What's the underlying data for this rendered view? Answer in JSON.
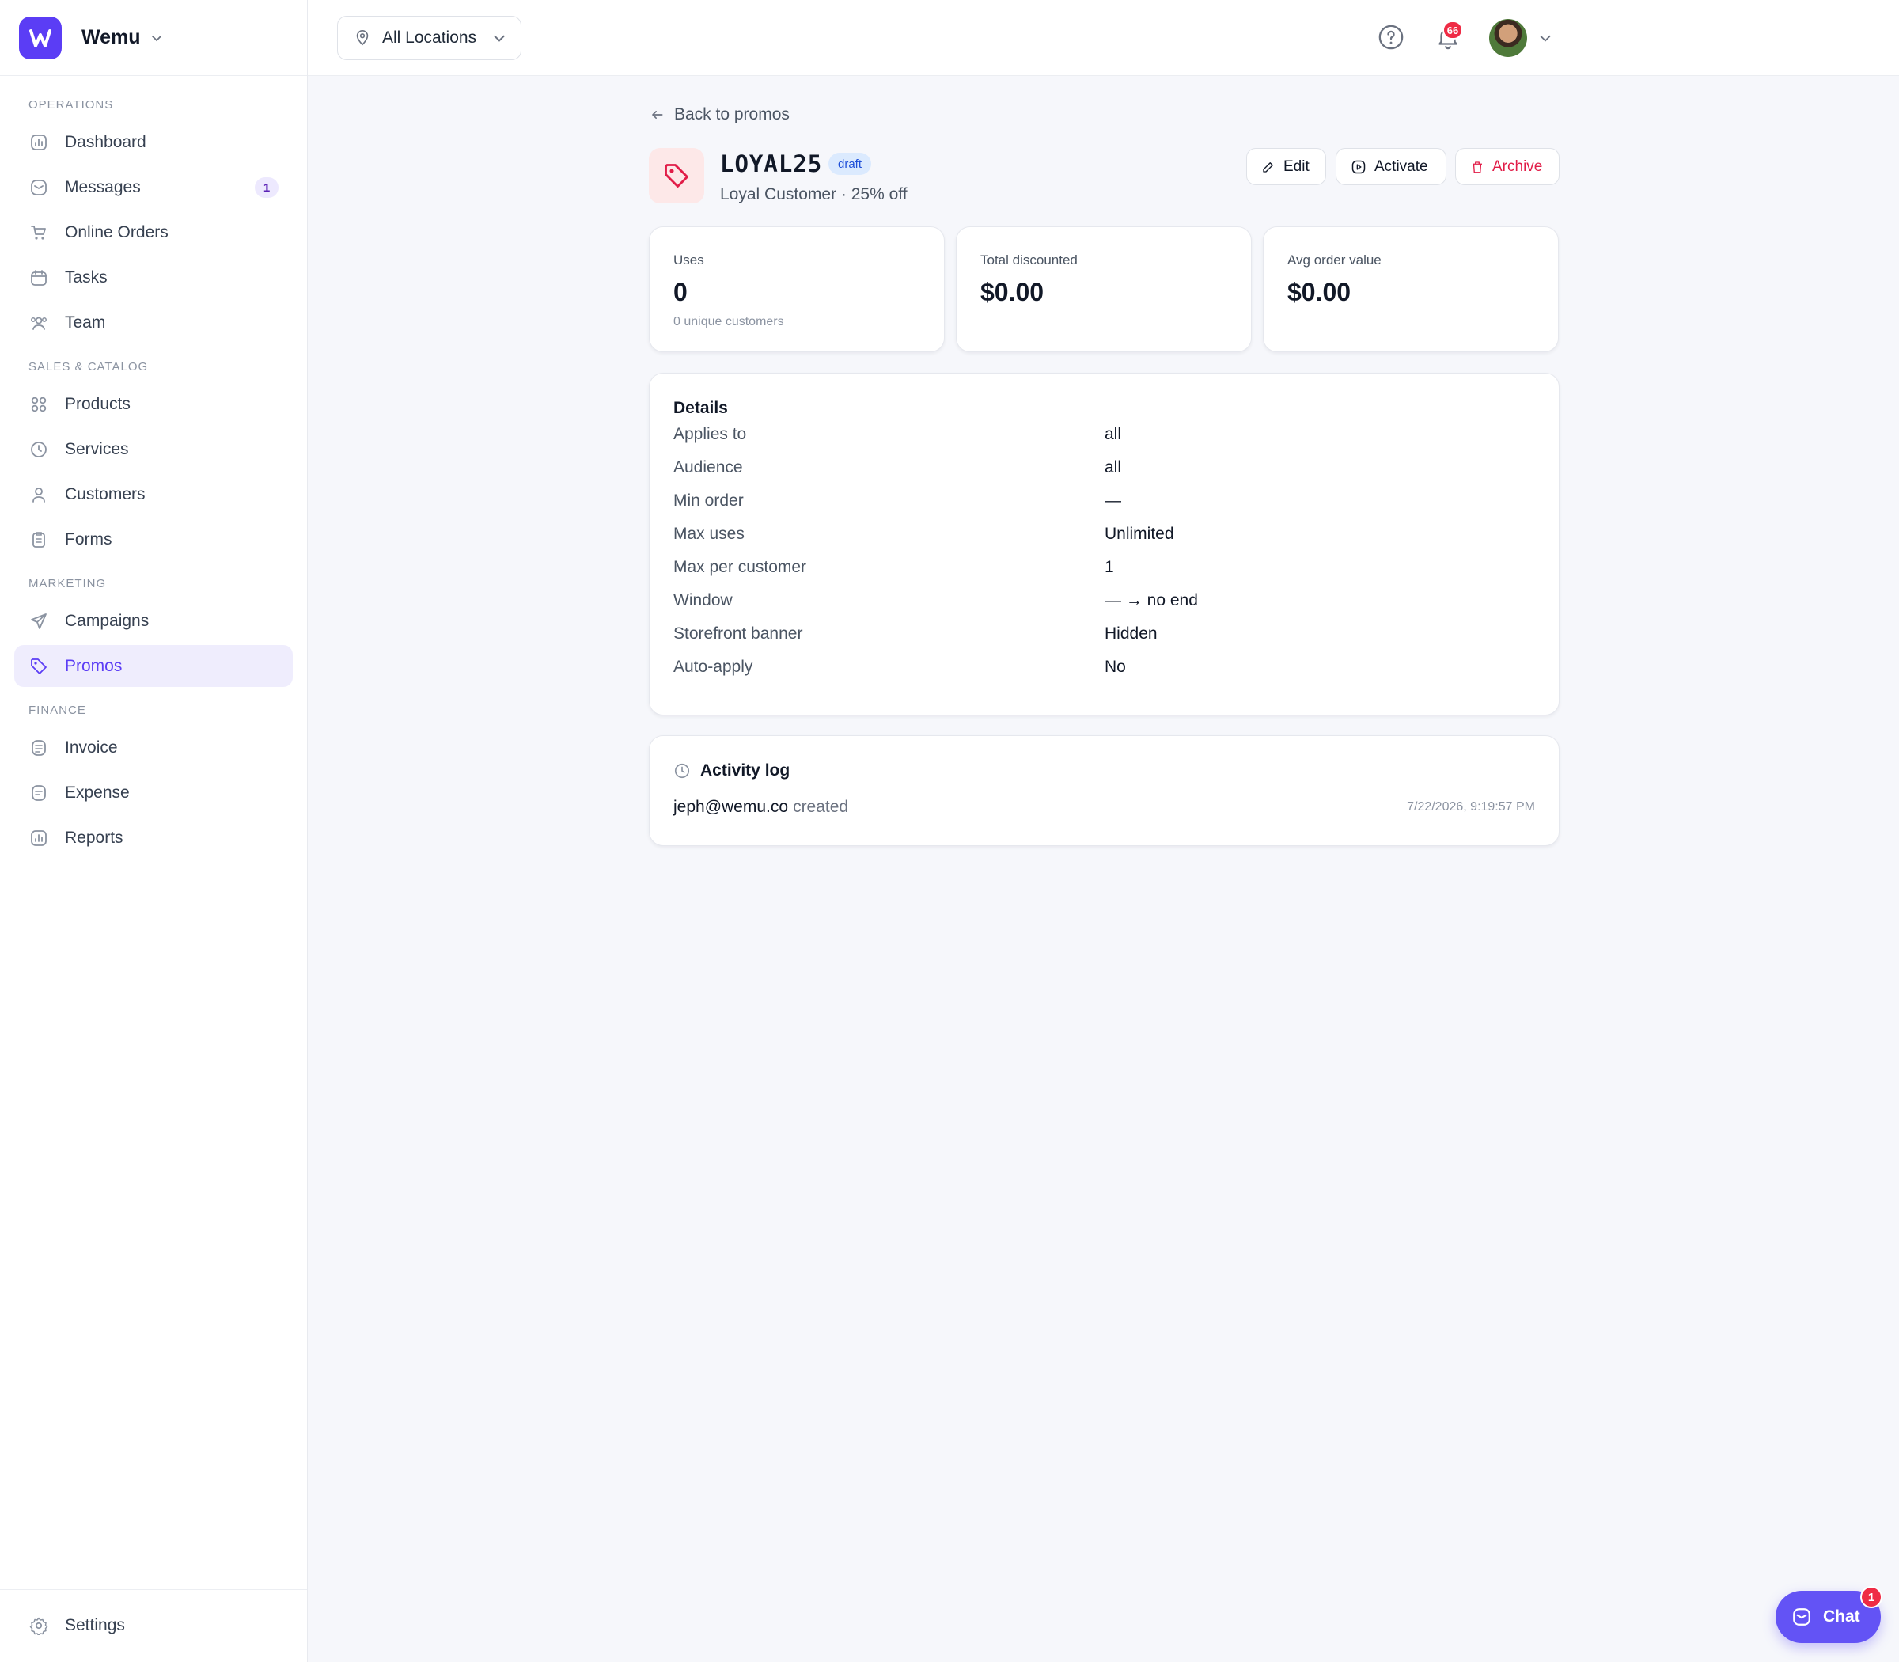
{
  "app": {
    "name": "Wemu"
  },
  "header": {
    "location": "All Locations",
    "notification_count": "66"
  },
  "sidebar": {
    "sections": [
      {
        "label": "OPERATIONS",
        "items": [
          {
            "label": "Dashboard",
            "icon": "chart-icon"
          },
          {
            "label": "Messages",
            "icon": "inbox-icon",
            "badge": "1"
          },
          {
            "label": "Online Orders",
            "icon": "cart-icon"
          },
          {
            "label": "Tasks",
            "icon": "calendar-icon"
          },
          {
            "label": "Team",
            "icon": "users-icon"
          }
        ]
      },
      {
        "label": "SALES & CATALOG",
        "items": [
          {
            "label": "Products",
            "icon": "grid-icon"
          },
          {
            "label": "Services",
            "icon": "clock-icon"
          },
          {
            "label": "Customers",
            "icon": "user-icon"
          },
          {
            "label": "Forms",
            "icon": "clipboard-icon"
          }
        ]
      },
      {
        "label": "MARKETING",
        "items": [
          {
            "label": "Campaigns",
            "icon": "send-icon"
          },
          {
            "label": "Promos",
            "icon": "tag-icon",
            "active": true
          }
        ]
      },
      {
        "label": "FINANCE",
        "items": [
          {
            "label": "Invoice",
            "icon": "document-icon"
          },
          {
            "label": "Expense",
            "icon": "receipt-icon"
          },
          {
            "label": "Reports",
            "icon": "chart-icon"
          }
        ]
      }
    ],
    "footer": {
      "label": "Settings",
      "icon": "gear-icon"
    }
  },
  "promo": {
    "back_label": "Back to promos",
    "code": "LOYAL25",
    "status": "draft",
    "subtitle": "Loyal Customer · 25% off",
    "actions": {
      "edit": "Edit",
      "activate": "Activate",
      "archive": "Archive"
    },
    "stats": [
      {
        "label": "Uses",
        "value": "0",
        "sub": "0 unique customers"
      },
      {
        "label": "Total discounted",
        "value": "$0.00",
        "sub": ""
      },
      {
        "label": "Avg order value",
        "value": "$0.00",
        "sub": ""
      }
    ],
    "details": {
      "title": "Details",
      "rows": [
        {
          "label": "Applies to",
          "value": "all"
        },
        {
          "label": "Audience",
          "value": "all"
        },
        {
          "label": "Min order",
          "value": "—"
        },
        {
          "label": "Max uses",
          "value": "Unlimited"
        },
        {
          "label": "Max per customer",
          "value": "1"
        },
        {
          "label": "Window",
          "value": "— → no end"
        },
        {
          "label": "Storefront banner",
          "value": "Hidden"
        },
        {
          "label": "Auto-apply",
          "value": "No"
        }
      ]
    },
    "activity": {
      "title": "Activity log",
      "entries": [
        {
          "user": "jeph@wemu.co",
          "action": "created",
          "time": "7/22/2026, 9:19:57 PM"
        }
      ]
    }
  },
  "chat": {
    "label": "Chat",
    "badge": "1"
  },
  "colors": {
    "accent": "#5b3df5",
    "danger": "#e11d48",
    "badge_red": "#ef2b45",
    "draft_bg": "#dbeafe"
  }
}
